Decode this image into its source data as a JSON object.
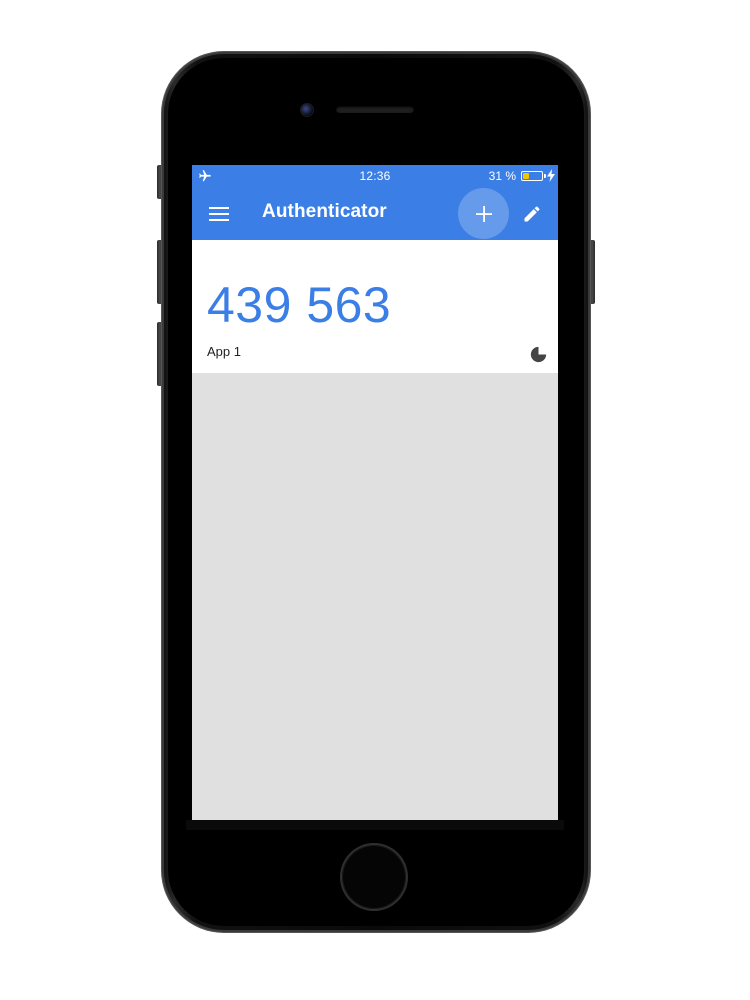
{
  "status_bar": {
    "time": "12:36",
    "battery_percent_label": "31 %",
    "battery_level": 0.31,
    "airplane_icon": "airplane-icon",
    "charging_icon": "lightning-bolt-icon"
  },
  "app_bar": {
    "title": "Authenticator",
    "menu_icon": "hamburger-menu-icon",
    "add_icon": "plus-icon",
    "edit_icon": "pencil-icon"
  },
  "accounts": [
    {
      "code": "439 563",
      "name": "App 1",
      "timer_icon": "countdown-timer-icon",
      "timer_remaining_fraction": 0.75
    }
  ],
  "colors": {
    "primary": "#3b7fe6",
    "code_text": "#3b7fe6",
    "background": "#e0e0e0",
    "battery_fill": "#f5c400",
    "timer": "#444444"
  }
}
